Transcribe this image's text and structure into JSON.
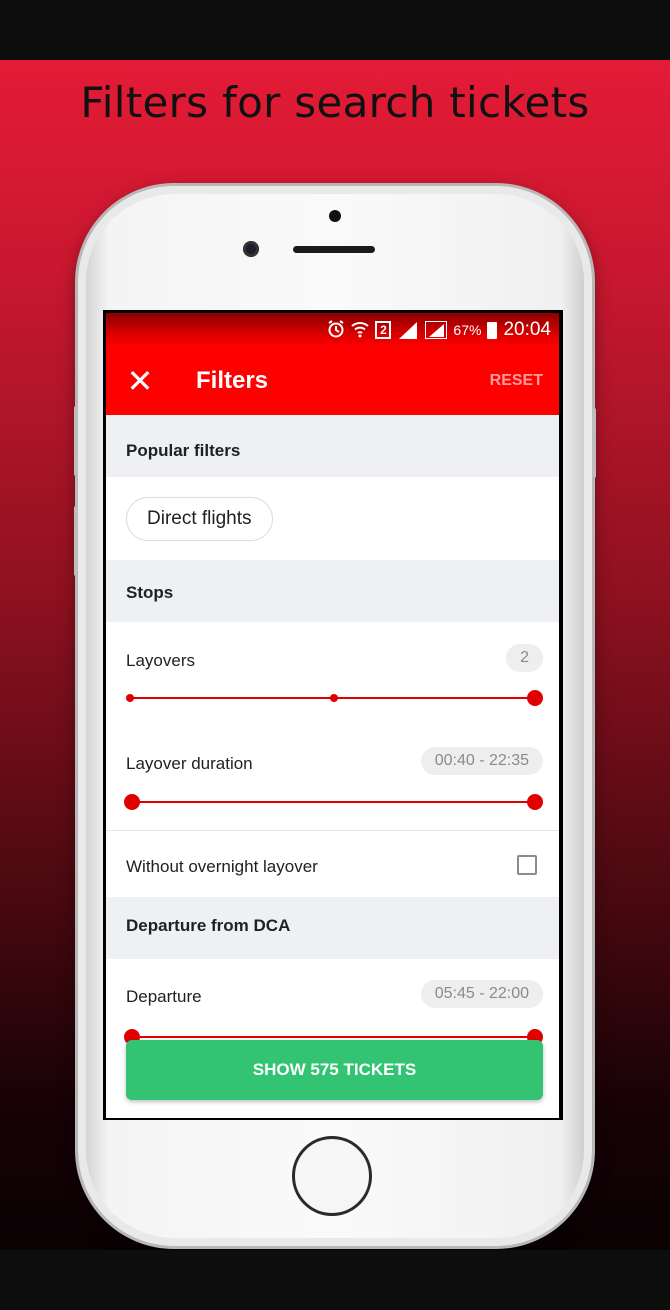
{
  "headline": "Filters for search tickets",
  "status_bar": {
    "sim_slot": "2",
    "battery": "67%",
    "time": "20:04"
  },
  "appbar": {
    "close_icon": "close-icon",
    "title": "Filters",
    "reset_label": "RESET"
  },
  "sections": {
    "popular": {
      "title": "Popular filters",
      "chip_label": "Direct flights"
    },
    "stops": {
      "title": "Stops",
      "layovers_label": "Layovers",
      "layovers_value": "2",
      "layovers_range": {
        "min": 0,
        "max": 2,
        "selected": 2
      },
      "duration_label": "Layover duration",
      "duration_value": "00:40 - 22:35",
      "overnight_label": "Without overnight layover",
      "overnight_checked": false
    },
    "departure": {
      "title": "Departure from DCA",
      "departure_label": "Departure",
      "departure_value": "05:45 - 22:00"
    }
  },
  "cta_label": "SHOW 575 TICKETS",
  "colors": {
    "accent": "#ff0000",
    "slider": "#e00000",
    "cta": "#33c473",
    "section_bg": "#eef0f3"
  }
}
